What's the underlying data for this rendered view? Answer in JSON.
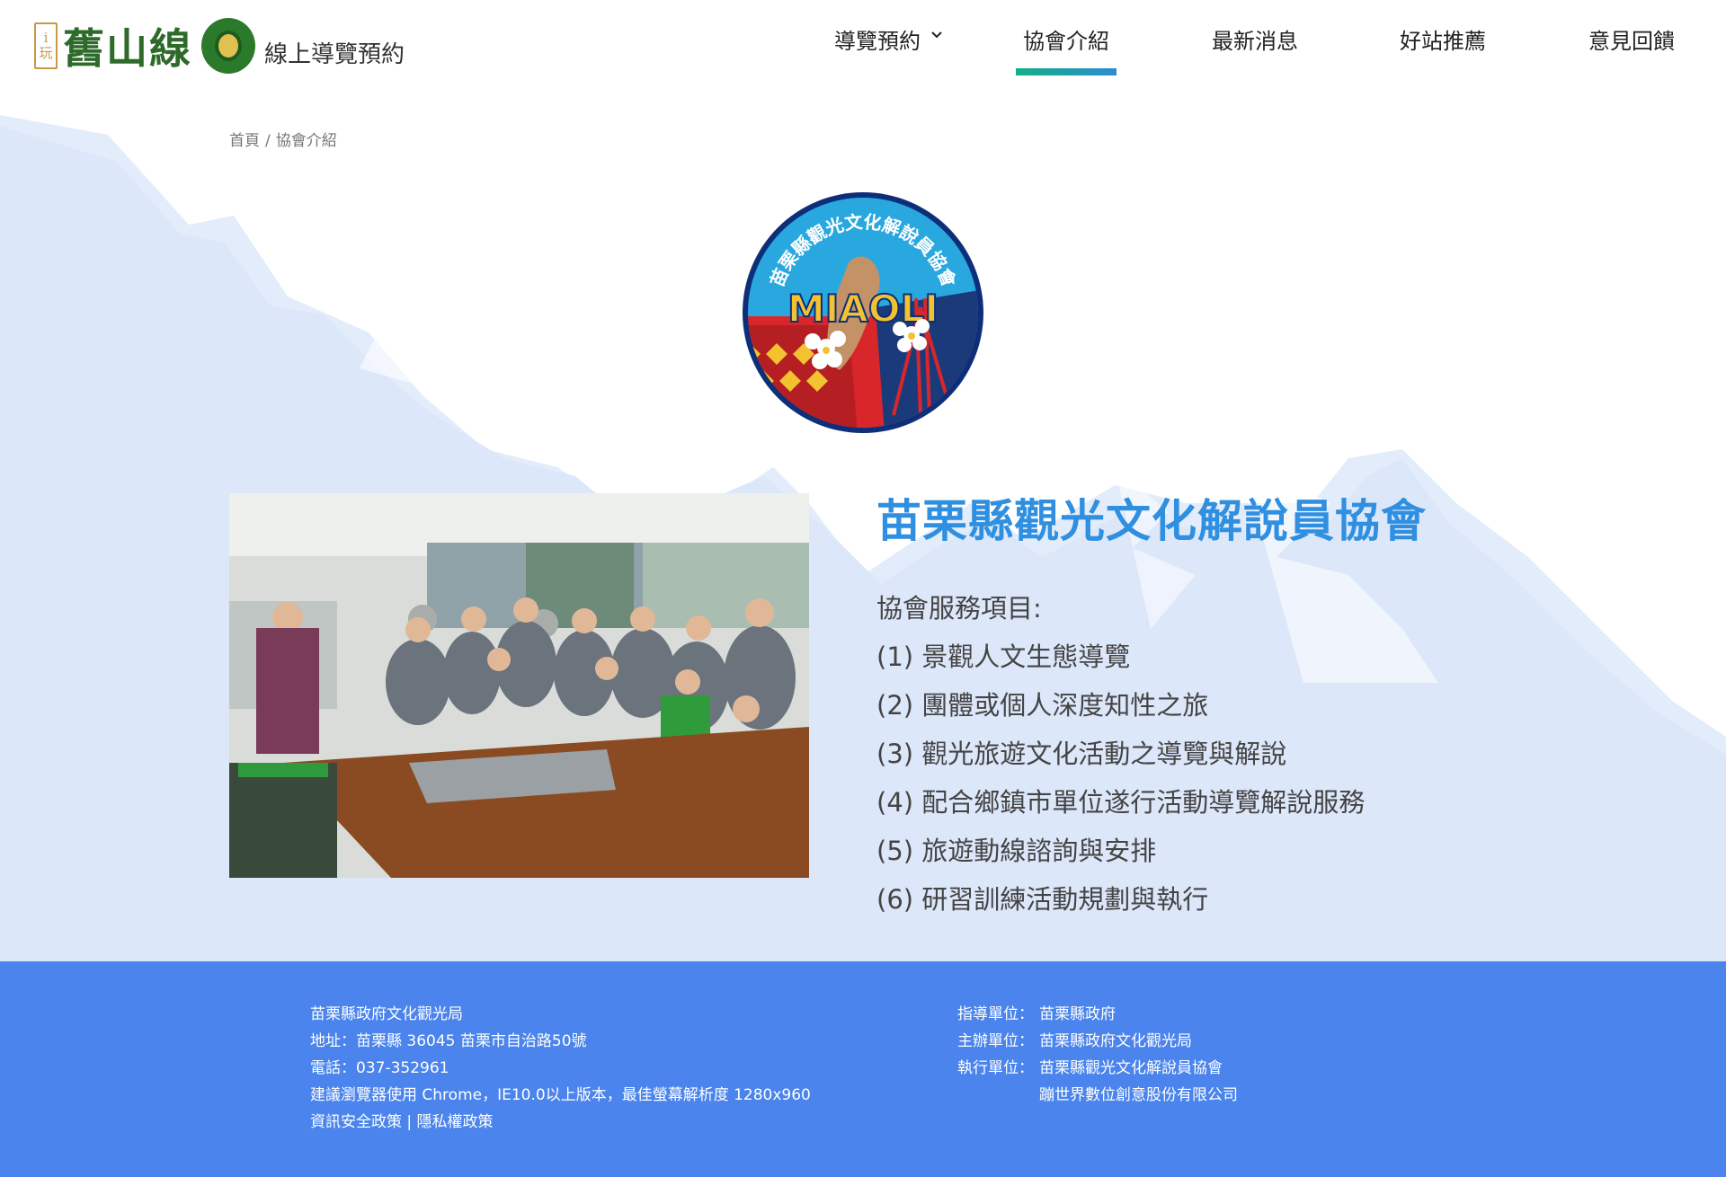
{
  "header": {
    "logo_badge_top": "i",
    "logo_badge_bottom": "玩",
    "logo_title": "舊山線",
    "logo_subtitle": "線上導覽預約",
    "nav": [
      {
        "label": "導覽預約",
        "has_dropdown": true
      },
      {
        "label": "協會介紹",
        "active": true
      },
      {
        "label": "最新消息"
      },
      {
        "label": "好站推薦"
      },
      {
        "label": "意見回饋"
      }
    ]
  },
  "breadcrumb": {
    "home": "首頁",
    "separator": "/",
    "current": "協會介紹"
  },
  "emblem": {
    "ring_text": "苗栗縣觀光文化解說員協會",
    "center_text": "MIAOLI"
  },
  "main": {
    "title": "苗栗縣觀光文化解說員協會",
    "services_heading": "協會服務項目:",
    "services": [
      "(1) 景觀人文生態導覽",
      "(2) 團體或個人深度知性之旅",
      "(3) 觀光旅遊文化活動之導覽與解說",
      "(4) 配合鄉鎮市單位遂行活動導覽解說服務",
      "(5) 旅遊動線諮詢與安排",
      "(6) 研習訓練活動規劃與執行"
    ]
  },
  "footer": {
    "org": "苗栗縣政府文化觀光局",
    "address": "地址：苗栗縣 36045 苗栗市自治路50號",
    "phone": "電話：037-352961",
    "browser": "建議瀏覽器使用 Chrome，IE10.0以上版本，最佳螢幕解析度 1280x960",
    "link_security": "資訊安全政策",
    "link_divider": "|",
    "link_privacy": "隱私權政策",
    "guide_label": "指導單位：",
    "guide_value": "苗栗縣政府",
    "host_label": "主辦單位：",
    "host_value": "苗栗縣政府文化觀光局",
    "exec_label": "執行單位：",
    "exec_value_1": "苗栗縣觀光文化解說員協會",
    "exec_value_2": "蹦世界數位創意股份有限公司"
  },
  "colors": {
    "title_blue": "#2f8fe0",
    "footer_blue": "#4a84ec",
    "mountain_light": "#e3ecfb",
    "nav_underline_start": "#12b085",
    "nav_underline_end": "#2d8cd0",
    "logo_green": "#2e6b2a"
  }
}
